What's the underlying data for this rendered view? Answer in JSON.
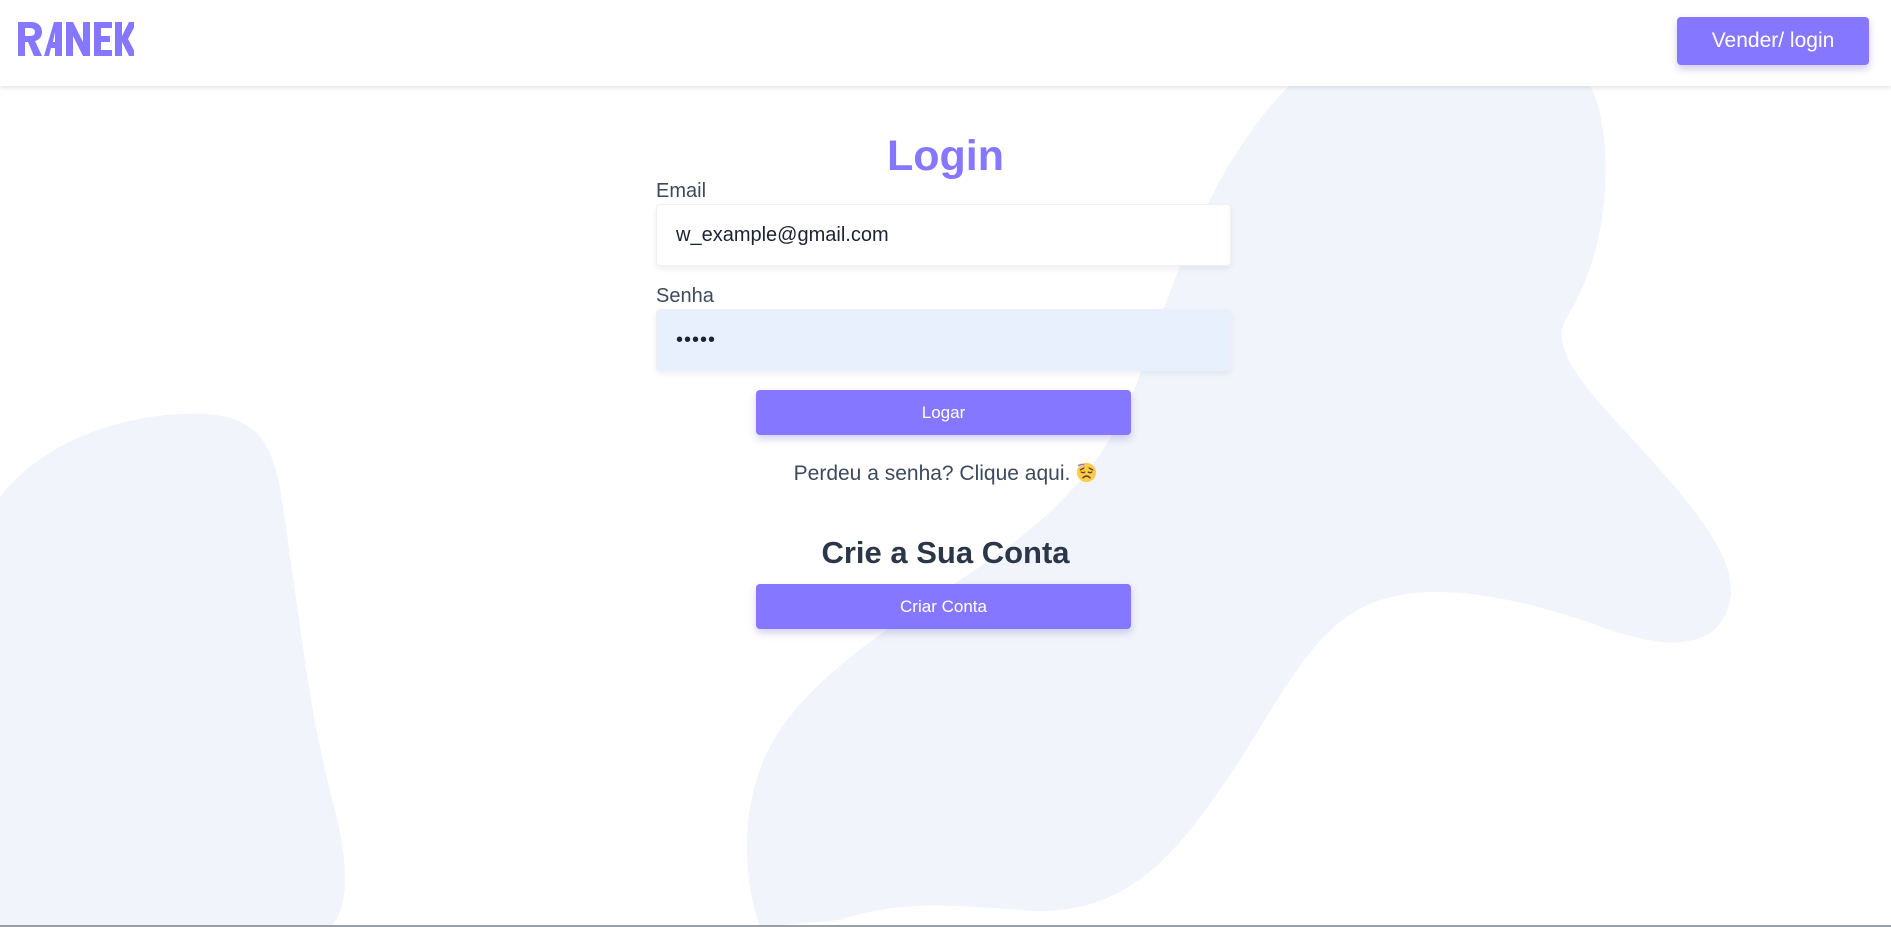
{
  "header": {
    "logo_text": "RANEK",
    "nav_button_label": "Vender/ login"
  },
  "login": {
    "title": "Login",
    "email_label": "Email",
    "email_value": "w_example@gmail.com",
    "password_label": "Senha",
    "password_value": "•••••",
    "submit_label": "Logar",
    "lost_password_text": "Perdeu a senha? Clique aqui.",
    "lost_password_emoji": "weary-face-icon"
  },
  "signup": {
    "title": "Crie a Sua Conta",
    "button_label": "Criar Conta"
  },
  "colors": {
    "accent": "#8577ff",
    "heading": "#2b3748",
    "text": "#3d4a5c",
    "blob": "#f1f4fa",
    "autofill": "#e8effd"
  }
}
